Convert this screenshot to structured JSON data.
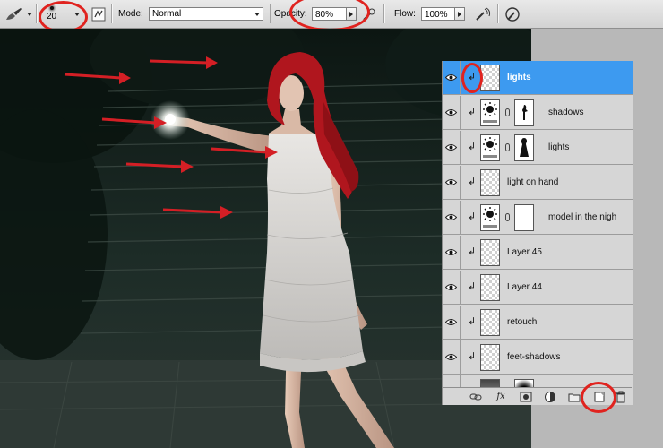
{
  "options_bar": {
    "brush_size": "20",
    "mode_label": "Mode:",
    "mode_value": "Normal",
    "opacity_label": "Opacity:",
    "opacity_value": "80%",
    "flow_label": "Flow:",
    "flow_value": "100%"
  },
  "layers": [
    {
      "name": "lights",
      "type": "pixel",
      "selected": true,
      "clipped": true
    },
    {
      "name": "shadows",
      "type": "adjustment",
      "mask": "figure-small",
      "clipped": true
    },
    {
      "name": "lights",
      "type": "adjustment",
      "mask": "figure-large",
      "clipped": true
    },
    {
      "name": "light on hand",
      "type": "pixel",
      "clipped": true
    },
    {
      "name": "model in the nigh",
      "type": "adjustment",
      "mask": "white",
      "clipped": true
    },
    {
      "name": "Layer 45",
      "type": "pixel",
      "clipped": true
    },
    {
      "name": "Layer 44",
      "type": "pixel",
      "clipped": true
    },
    {
      "name": "retouch",
      "type": "pixel",
      "clipped": true
    },
    {
      "name": "feet-shadows",
      "type": "pixel",
      "clipped": true
    }
  ],
  "icons": {
    "footer": [
      "link-layers-icon",
      "fx-icon",
      "add-mask-icon",
      "adjustment-layer-icon",
      "new-group-icon",
      "new-layer-icon",
      "trash-icon"
    ]
  },
  "colors": {
    "selection": "#3d9af0",
    "annotation": "#e0231f",
    "hair": "#b0161e",
    "background_scene": "#15211d"
  }
}
